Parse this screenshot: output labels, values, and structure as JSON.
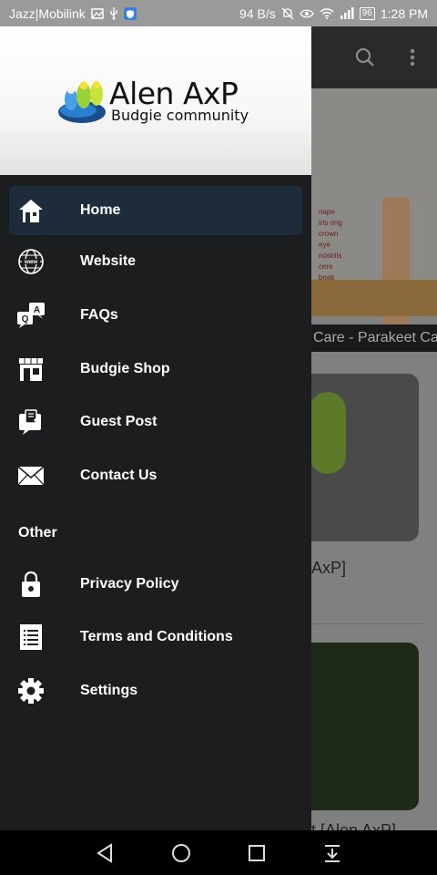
{
  "status_bar": {
    "carrier": "Jazz|Mobilink",
    "speed": "94 B/s",
    "battery": "96",
    "time": "1:28 PM"
  },
  "drawer": {
    "logo": {
      "title": "Alen AxP",
      "subtitle": "Budgie community"
    },
    "items": [
      {
        "label": "Home",
        "icon": "home-icon",
        "active": true
      },
      {
        "label": "Website",
        "icon": "globe-icon",
        "active": false
      },
      {
        "label": "FAQs",
        "icon": "faq-chat-icon",
        "active": false
      },
      {
        "label": "Budgie Shop",
        "icon": "shop-icon",
        "active": false
      },
      {
        "label": "Guest Post",
        "icon": "guest-post-icon",
        "active": false
      },
      {
        "label": "Contact Us",
        "icon": "envelope-icon",
        "active": false
      }
    ],
    "section_other": "Other",
    "other_items": [
      {
        "label": "Privacy Policy",
        "icon": "lock-icon"
      },
      {
        "label": "Terms and Conditions",
        "icon": "document-icon"
      },
      {
        "label": "Settings",
        "icon": "gear-icon"
      }
    ]
  },
  "background": {
    "caption": "Care - Parakeet Ca",
    "card_title_1": "AxP]",
    "card_title_2": "t [Alen AxP]",
    "image_labels": [
      "nape",
      "iris ring",
      "crown",
      "eye",
      "nostrils",
      "cere",
      "beak"
    ]
  },
  "colors": {
    "drawer_bg": "#1c1d1f",
    "active_item_bg": "#1e2b3b",
    "status_bar_bg": "#9a9a9a"
  }
}
